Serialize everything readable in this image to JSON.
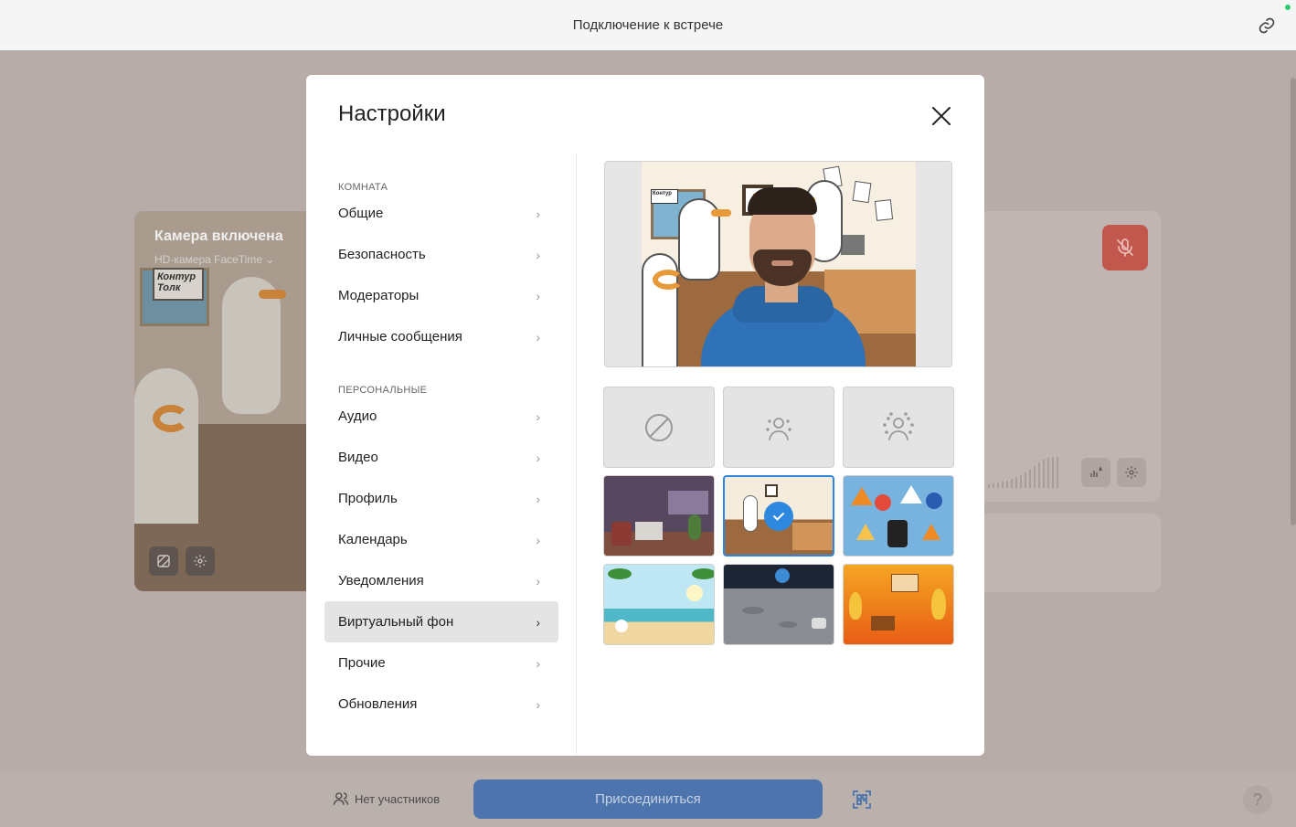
{
  "topbar": {
    "title": "Подключение к встрече",
    "link_icon": "link-icon"
  },
  "camera_card": {
    "title": "Камера включена",
    "device": "HD-камера FaceTime",
    "sign_text": "Контур Толк"
  },
  "modal": {
    "title": "Настройки",
    "close_icon": "close-icon",
    "sections": [
      {
        "label": "КОМНАТА",
        "items": [
          "Общие",
          "Безопасность",
          "Модераторы",
          "Личные сообщения"
        ]
      },
      {
        "label": "ПЕРСОНАЛЬНЫЕ",
        "items": [
          "Аудио",
          "Видео",
          "Профиль",
          "Календарь",
          "Уведомления",
          "Виртуальный фон",
          "Прочие",
          "Обновления"
        ]
      }
    ],
    "active_item": "Виртуальный фон",
    "preview": {
      "sign_text": "Контур"
    },
    "backgrounds": [
      {
        "name": "none",
        "icon": "no-background-icon"
      },
      {
        "name": "blur-light",
        "icon": "blur-person-icon"
      },
      {
        "name": "blur-strong",
        "icon": "blur-person-strong-icon"
      },
      {
        "name": "room"
      },
      {
        "name": "office-gulls",
        "selected": true
      },
      {
        "name": "road-signs"
      },
      {
        "name": "beach"
      },
      {
        "name": "moon"
      },
      {
        "name": "fire"
      }
    ]
  },
  "bottombar": {
    "participants": "Нет участников",
    "join_label": "Присоединиться",
    "help": "?"
  },
  "colors": {
    "accent": "#2f88e0",
    "join_button": "#4d74ad",
    "mic_off": "#c2574e",
    "status_online": "#2ecc71"
  }
}
